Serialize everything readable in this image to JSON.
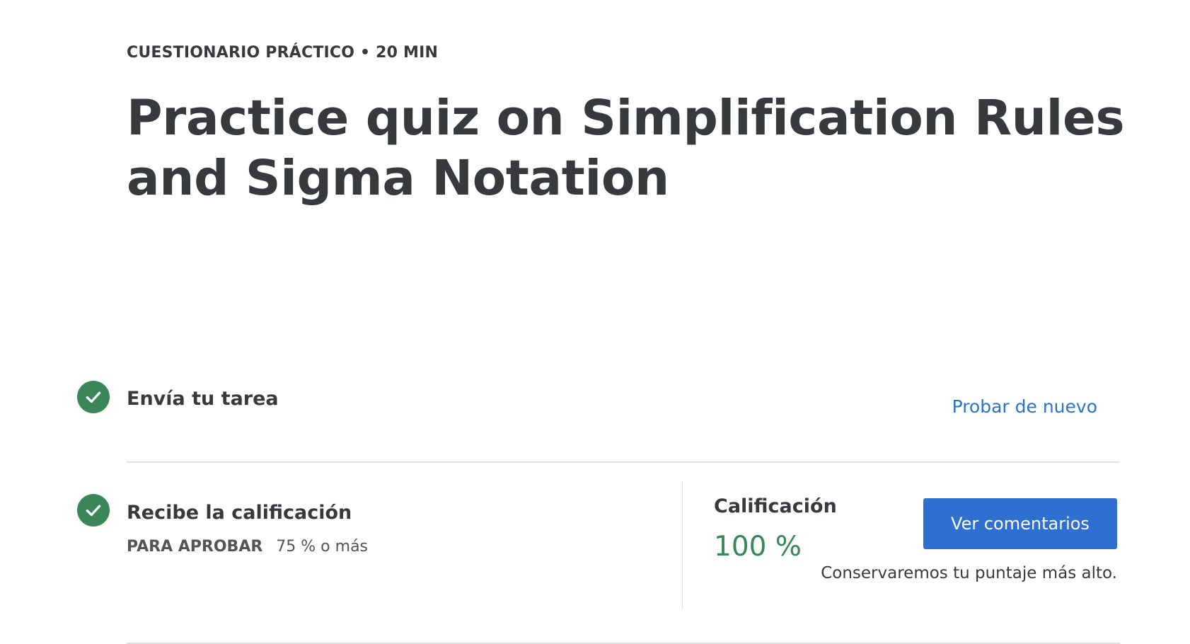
{
  "header": {
    "eyebrow": "CUESTIONARIO PRÁCTICO • 20 MIN",
    "title": "Practice quiz on Simplification Rules and Sigma Notation"
  },
  "steps": [
    {
      "title": "Envía tu tarea",
      "icon": "checkmark-icon",
      "completed": true,
      "action_label": "Probar de nuevo"
    },
    {
      "title": "Recibe la calificación",
      "icon": "checkmark-icon",
      "completed": true,
      "pass_label": "PARA APROBAR",
      "pass_value": "75 % o más"
    }
  ],
  "grade": {
    "label": "Calificación",
    "value": "100 %",
    "button_label": "Ver comentarios",
    "note": "Conservaremos tu puntaje más alto."
  },
  "colors": {
    "success": "#3b8659",
    "link": "#2a73cc",
    "button": "#2f6fd1",
    "text": "#373a3c"
  }
}
